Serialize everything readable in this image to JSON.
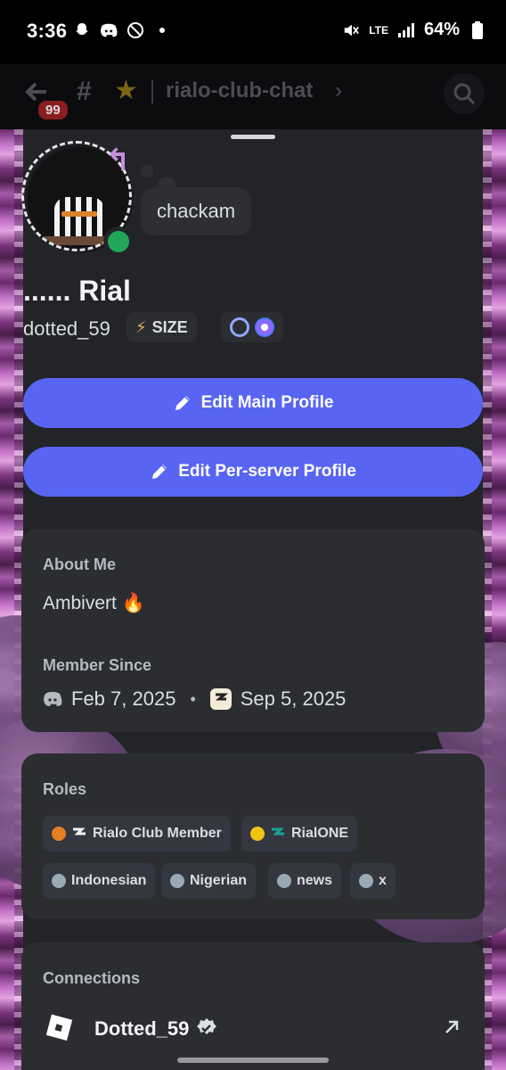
{
  "status_bar": {
    "time": "3:36",
    "network": "LTE",
    "battery": "64%"
  },
  "header": {
    "badge_count": "99",
    "channel_name": "rialo-club-chat"
  },
  "profile": {
    "status_text": "chackam",
    "display_name": "...... Rial",
    "username": "dotted_59",
    "tag_label": "SIZE",
    "presence_color": "#23a55a"
  },
  "actions": {
    "edit_main": "Edit Main Profile",
    "edit_server": "Edit Per-server Profile"
  },
  "about": {
    "heading": "About Me",
    "text": "Ambivert 🔥",
    "member_since_heading": "Member Since",
    "discord_date": "Feb 7, 2025",
    "server_date": "Sep 5, 2025"
  },
  "roles": {
    "heading": "Roles",
    "items": [
      {
        "label": "Rialo Club Member",
        "color": "#e67e22"
      },
      {
        "label": "RialONE",
        "color": "#f1c40f"
      },
      {
        "label": "Indonesian",
        "color": "#99aab5"
      },
      {
        "label": "Nigerian",
        "color": "#99aab5"
      },
      {
        "label": "news",
        "color": "#99aab5"
      },
      {
        "label": "x",
        "color": "#99aab5"
      }
    ]
  },
  "connections": {
    "heading": "Connections",
    "name": "Dotted_59"
  },
  "colors": {
    "blurple": "#5865f2",
    "card": "#2b2d31",
    "sheet": "#232428"
  }
}
